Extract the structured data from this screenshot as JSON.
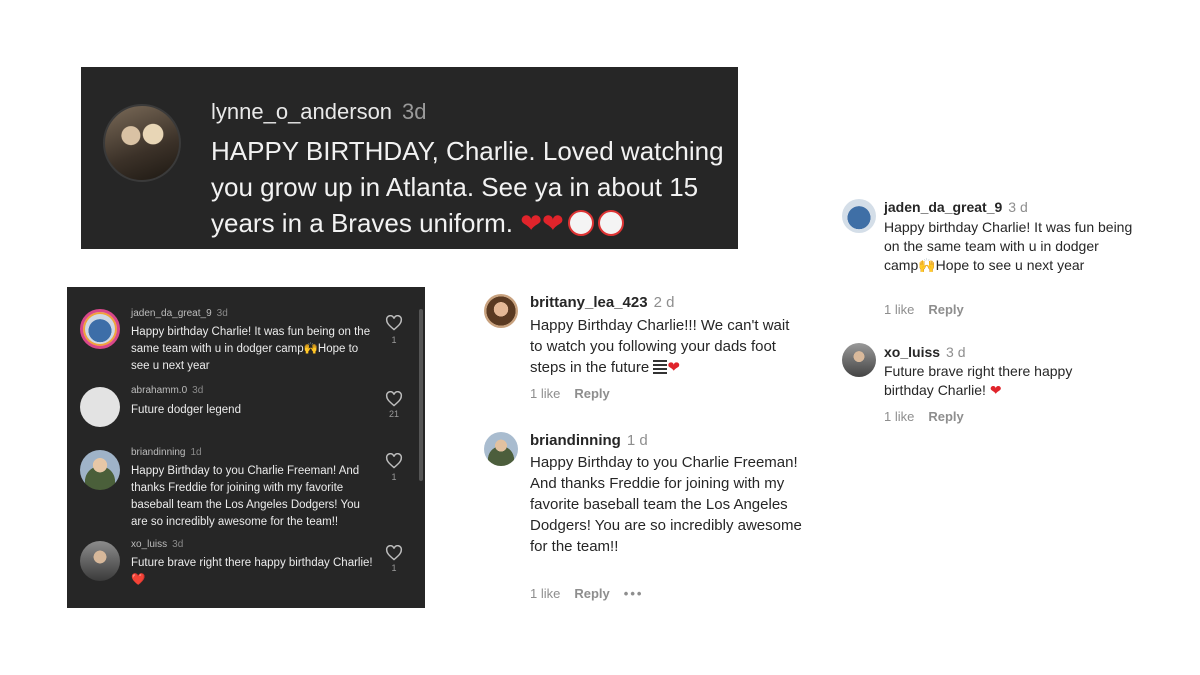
{
  "big_card": {
    "username": "lynne_o_anderson",
    "time": "3d",
    "text": "HAPPY BIRTHDAY, Charlie. Loved watching you grow up in Atlanta. See ya in about 15 years  in a Braves uniform.",
    "emoji_tail": "❤️❤️⚾⚾"
  },
  "dark_panel": {
    "comments": [
      {
        "username": "jaden_da_great_9",
        "time": "3d",
        "text": "Happy birthday Charlie! It was fun being on the same team with u in dodger camp🙌Hope to see u next year",
        "likes": "1"
      },
      {
        "username": "abrahamm.0",
        "time": "3d",
        "text": "Future dodger legend",
        "likes": "21"
      },
      {
        "username": "briandinning",
        "time": "1d",
        "text": "Happy Birthday to you Charlie Freeman! And thanks Freddie for joining with my favorite baseball team the Los Angeles Dodgers! You are so incredibly awesome for the team!!",
        "likes": "1"
      },
      {
        "username": "xo_luiss",
        "time": "3d",
        "text": "Future brave right there happy birthday Charlie! ❤️",
        "likes": "1"
      }
    ]
  },
  "light_comments": [
    {
      "username": "brittany_lea_423",
      "time": "2 d",
      "text": "Happy Birthday Charlie!!! We can't wait to watch you following your dads foot steps in the future",
      "likes": "1 like",
      "reply": "Reply"
    },
    {
      "username": "briandinning",
      "time": "1 d",
      "text": "Happy Birthday to you Charlie Freeman! And thanks Freddie for joining with my favorite baseball team the Los Angeles Dodgers! You are so incredibly awesome for the team!!",
      "likes": "1 like",
      "reply": "Reply",
      "more": "•••"
    },
    {
      "username": "jaden_da_great_9",
      "time": "3 d",
      "text": "Happy birthday Charlie! It was fun being on the same team with u in dodger camp🙌Hope to see u next year",
      "likes": "1 like",
      "reply": "Reply"
    },
    {
      "username": "xo_luiss",
      "time": "3 d",
      "text": "Future brave right there happy birthday Charlie!",
      "likes": "1 like",
      "reply": "Reply"
    }
  ],
  "colors": {
    "dark_bg": "#262626",
    "heart": "#e0242b"
  },
  "icons": [
    "heart-icon",
    "avatar",
    "more-options-icon"
  ]
}
